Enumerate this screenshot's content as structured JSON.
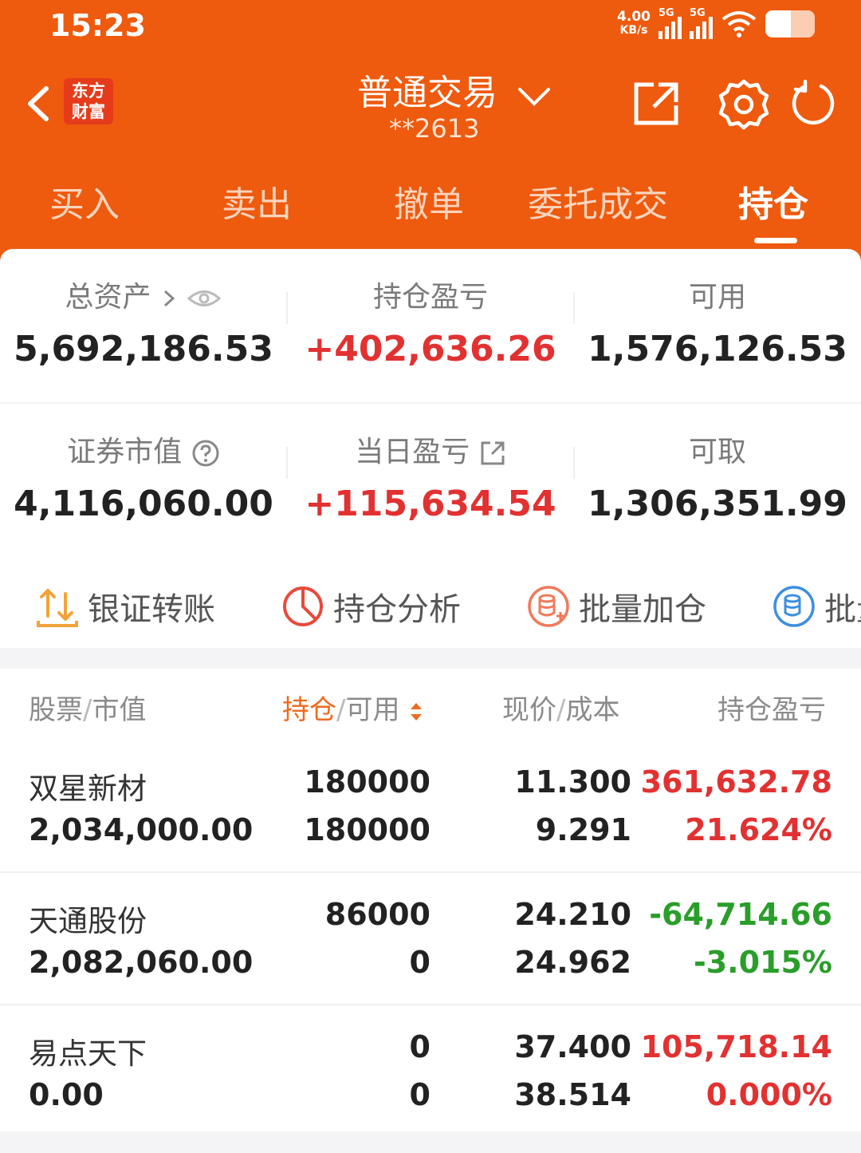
{
  "status_bar": {
    "time": "15:23",
    "net_speed": "4.00",
    "net_unit": "KB/s",
    "sim1": "5G",
    "sim2": "5G"
  },
  "header": {
    "logo_line1": "东方",
    "logo_line2": "财富",
    "title": "普通交易",
    "account": "**2613"
  },
  "tabs": [
    "买入",
    "卖出",
    "撤单",
    "委托成交",
    "持仓"
  ],
  "summary": {
    "total_assets_label": "总资产",
    "total_assets": "5,692,186.53",
    "position_pnl_label": "持仓盈亏",
    "position_pnl": "+402,636.26",
    "available_label": "可用",
    "available": "1,576,126.53",
    "market_value_label": "证券市值",
    "market_value": "4,116,060.00",
    "daily_pnl_label": "当日盈亏",
    "daily_pnl": "+115,634.54",
    "withdrawable_label": "可取",
    "withdrawable": "1,306,351.99"
  },
  "quick_actions": [
    "银证转账",
    "持仓分析",
    "批量加仓",
    "批量"
  ],
  "columns": {
    "stock": "股票",
    "market_value": "市值",
    "position": "持仓",
    "available": "可用",
    "price": "现价",
    "cost": "成本",
    "pnl": "持仓盈亏"
  },
  "holdings": [
    {
      "name": "双星新材",
      "market_value": "2,034,000.00",
      "position": "180000",
      "available": "180000",
      "price": "11.300",
      "cost": "9.291",
      "pnl": "361,632.78",
      "pnl_pct": "21.624%",
      "trend": "up"
    },
    {
      "name": "天通股份",
      "market_value": "2,082,060.00",
      "position": "86000",
      "available": "0",
      "price": "24.210",
      "cost": "24.962",
      "pnl": "-64,714.66",
      "pnl_pct": "-3.015%",
      "trend": "down"
    },
    {
      "name": "易点天下",
      "market_value": "0.00",
      "position": "0",
      "available": "0",
      "price": "37.400",
      "cost": "38.514",
      "pnl": "105,718.14",
      "pnl_pct": "0.000%",
      "trend": "up"
    }
  ],
  "colors": {
    "brand": "#ee5a0e",
    "profit": "#e23131",
    "loss": "#2a9e2a"
  }
}
